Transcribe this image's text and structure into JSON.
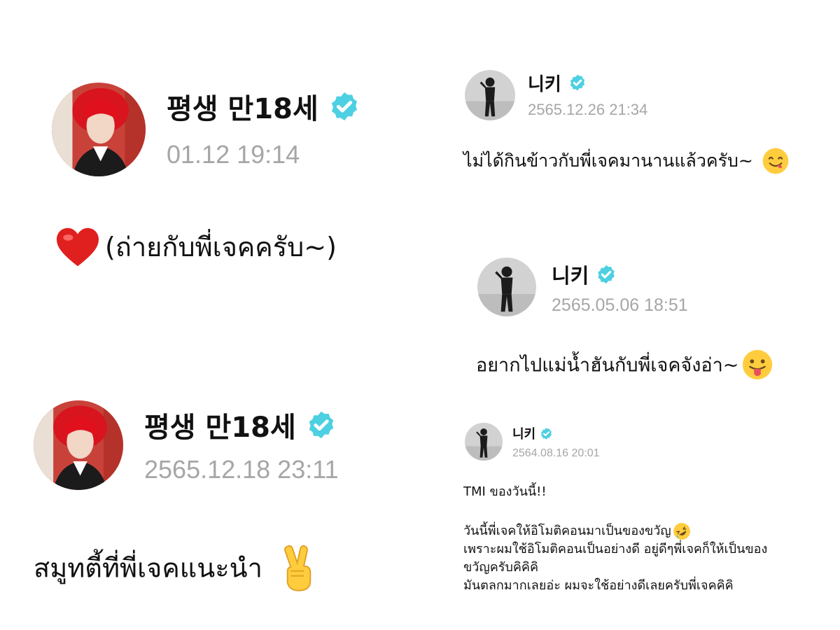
{
  "colors": {
    "verified_badge": "#4dd0e1",
    "timestamp": "#a6a6a6",
    "text": "#111111",
    "background": "#ffffff"
  },
  "posts": [
    {
      "author": "평생 만18세",
      "timestamp": "01.12 19:14",
      "icon": "heart-emoji",
      "text": "(ถ่ายกับพี่เจคครับ~)"
    },
    {
      "author": "평생 만18세",
      "timestamp": "2565.12.18 23:11",
      "text": "สมูทตี้ที่พี่เจคแนะนำ",
      "icon": "victory-hand-emoji"
    },
    {
      "author": "니키",
      "timestamp": "2565.12.26 21:34",
      "text": "ไม่ได้กินข้าวกับพี่เจคมานานแล้วครับ~",
      "icon": "savoring-face-emoji"
    },
    {
      "author": "니키",
      "timestamp": "2565.05.06 18:51",
      "text": "อยากไปแม่น้ำฮันกับพี่เจคจังอ่า~",
      "icon": "tongue-face-emoji"
    },
    {
      "author": "니키",
      "timestamp": "2564.08.16 20:01",
      "line1": "TMI ของวันนี้!!",
      "line2": "วันนี้พี่เจคให้อิโมติคอนมาเป็นของขวัญ",
      "line2_icon": "rolling-laughing-emoji",
      "line3": "เพราะผมใช้อิโมติคอนเป็นอย่างดี อยู่ดีๆพี่เจคก็ให้เป็นของ",
      "line4": "ขวัญครับคิคิคิ",
      "line5": "มันตลกมากเลยอ่ะ ผมจะใช้อย่างดีเลยครับพี่เจคคิคิ"
    }
  ]
}
